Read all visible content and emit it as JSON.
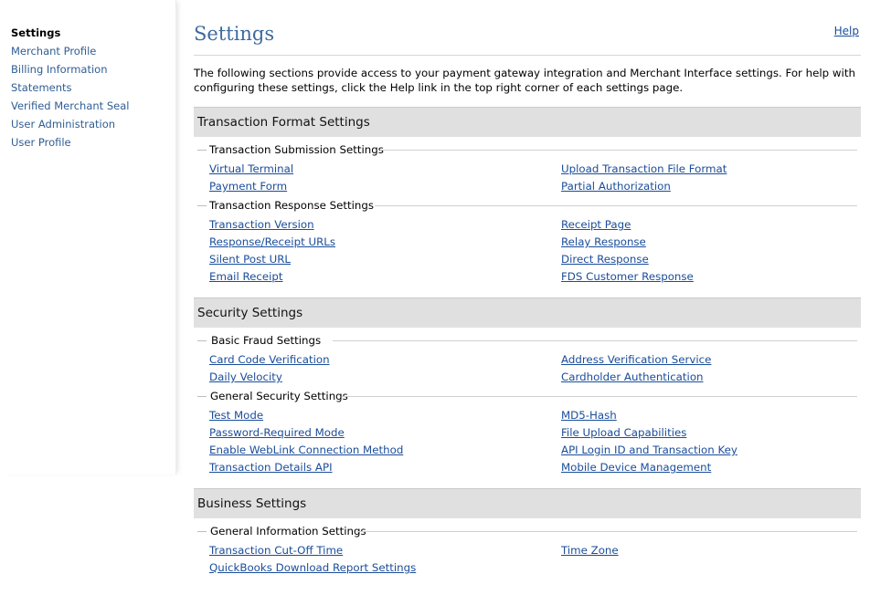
{
  "sidebar": {
    "items": [
      {
        "label": "Settings",
        "active": true
      },
      {
        "label": "Merchant Profile"
      },
      {
        "label": "Billing Information"
      },
      {
        "label": "Statements"
      },
      {
        "label": "Verified Merchant Seal"
      },
      {
        "label": "User Administration"
      },
      {
        "label": "User Profile"
      }
    ]
  },
  "header": {
    "title": "Settings",
    "help_label": "Help"
  },
  "intro": "The following sections provide access to your payment gateway integration and Merchant Interface settings. For help with configuring these settings, click the Help link in the top right corner of each settings page.",
  "sections": {
    "transaction_format": {
      "title": "Transaction Format Settings",
      "submission": {
        "title": "Transaction Submission Settings",
        "left": [
          "Virtual Terminal",
          "Payment Form"
        ],
        "right": [
          "Upload Transaction File Format",
          "Partial Authorization"
        ]
      },
      "response": {
        "title": "Transaction Response Settings",
        "left": [
          "Transaction Version",
          "Response/Receipt URLs",
          "Silent Post URL",
          "Email Receipt"
        ],
        "right": [
          "Receipt Page",
          "Relay Response",
          "Direct Response",
          "FDS Customer Response"
        ]
      }
    },
    "security": {
      "title": "Security Settings",
      "basic_fraud": {
        "title": "Basic Fraud Settings",
        "left": [
          "Card Code Verification",
          "Daily Velocity"
        ],
        "right": [
          "Address Verification Service",
          "Cardholder Authentication"
        ]
      },
      "general_security": {
        "title": "General Security Settings",
        "left": [
          "Test Mode",
          "Password-Required Mode",
          "Enable WebLink Connection Method",
          "Transaction Details API"
        ],
        "right": [
          "MD5-Hash",
          "File Upload Capabilities",
          "API Login ID and Transaction Key",
          "Mobile Device Management"
        ]
      }
    },
    "business": {
      "title": "Business Settings",
      "general_info": {
        "title": "General Information Settings",
        "left": [
          "Transaction Cut-Off Time",
          "QuickBooks Download Report Settings"
        ],
        "right": [
          "Time Zone"
        ]
      }
    }
  }
}
